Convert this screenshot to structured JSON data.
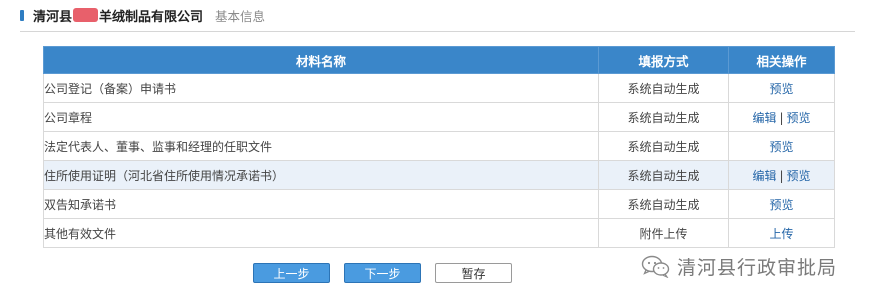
{
  "header": {
    "company_prefix": "清河县",
    "company_suffix": "羊绒制品有限公司",
    "subtitle": "基本信息"
  },
  "table": {
    "columns": [
      "材料名称",
      "填报方式",
      "相关操作"
    ],
    "rows": [
      {
        "name": "公司登记（备案）申请书",
        "method": "系统自动生成",
        "actions": [
          "预览"
        ],
        "highlighted": false
      },
      {
        "name": "公司章程",
        "method": "系统自动生成",
        "actions": [
          "编辑",
          "预览"
        ],
        "highlighted": false
      },
      {
        "name": "法定代表人、董事、监事和经理的任职文件",
        "method": "系统自动生成",
        "actions": [
          "预览"
        ],
        "highlighted": false
      },
      {
        "name": "住所使用证明（河北省住所使用情况承诺书）",
        "method": "系统自动生成",
        "actions": [
          "编辑",
          "预览"
        ],
        "highlighted": true
      },
      {
        "name": "双告知承诺书",
        "method": "系统自动生成",
        "actions": [
          "预览"
        ],
        "highlighted": false
      },
      {
        "name": "其他有效文件",
        "method": "附件上传",
        "actions": [
          "上传"
        ],
        "highlighted": false
      }
    ]
  },
  "buttons": {
    "prev": "上一步",
    "next": "下一步",
    "save": "暂存"
  },
  "watermark": {
    "text": "清河县行政审批局",
    "icon": "wechat-icon"
  },
  "colors": {
    "header_blue": "#3a86c9",
    "link_blue": "#2566a8",
    "redaction": "#e8606b",
    "highlight_row": "#eaf1f9"
  }
}
